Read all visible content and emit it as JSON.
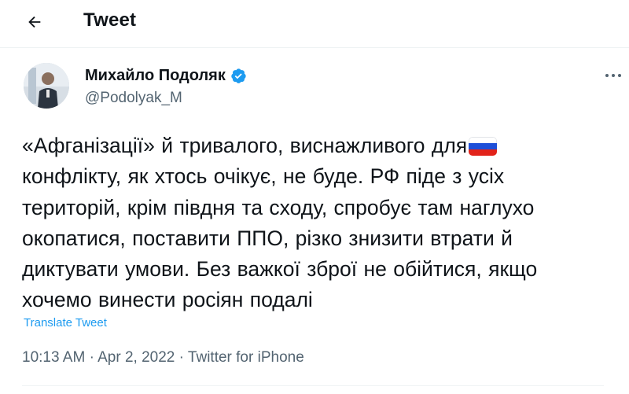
{
  "header": {
    "title": "Tweet",
    "back_icon": "arrow-left-icon"
  },
  "author": {
    "name": "Михайло Подоляк",
    "handle": "@Podolyak_M",
    "verified_icon": "verified-badge-icon",
    "more_icon": "more-horizontal-icon"
  },
  "tweet": {
    "lines": [
      "«Афганізації» й тривалого, виснажливого для",
      "конфлікту, як хтось очікує, не буде. РФ піде з усіх",
      "територій, крім півдня та сходу, спробує там наглухо",
      "окопатися, поставити ППО, різко знизити втрати й",
      "диктувати умови. Без важкої зброї не обійтися, якщо",
      "хочемо винести росіян подалі"
    ],
    "emoji_name": "russia-flag-emoji",
    "translate_label": "Translate Tweet"
  },
  "meta": {
    "time": "10:13 AM",
    "separator": "·",
    "date": "Apr 2, 2022",
    "source": "Twitter for iPhone"
  },
  "colors": {
    "accent": "#1d9bf0",
    "text": "#0f1419",
    "muted": "#536471",
    "divider": "#eff3f4"
  }
}
